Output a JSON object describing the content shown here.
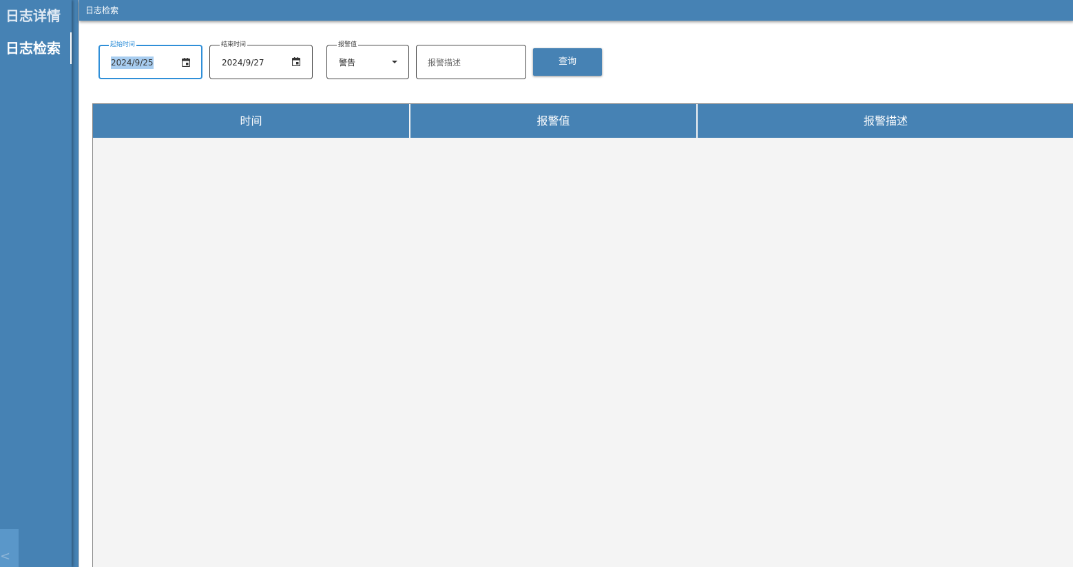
{
  "sidebar": {
    "items": [
      {
        "label": "日志详情"
      },
      {
        "label": "日志检索"
      }
    ],
    "collapse_label": "<"
  },
  "header": {
    "title": "日志检索"
  },
  "filters": {
    "start": {
      "label": "起始时间",
      "value": "2024/9/25"
    },
    "end": {
      "label": "结束时间",
      "value": "2024/9/27"
    },
    "alarm": {
      "label": "报警值",
      "value": "警告"
    },
    "description": {
      "placeholder": "报警描述"
    },
    "query_label": "查询"
  },
  "table": {
    "columns": [
      {
        "label": "时间"
      },
      {
        "label": "报警值"
      },
      {
        "label": "报警描述"
      }
    ],
    "rows": []
  },
  "colors": {
    "accent": "#4682b4",
    "focus": "#2f8fd8",
    "table_body": "#f4f4f4"
  }
}
